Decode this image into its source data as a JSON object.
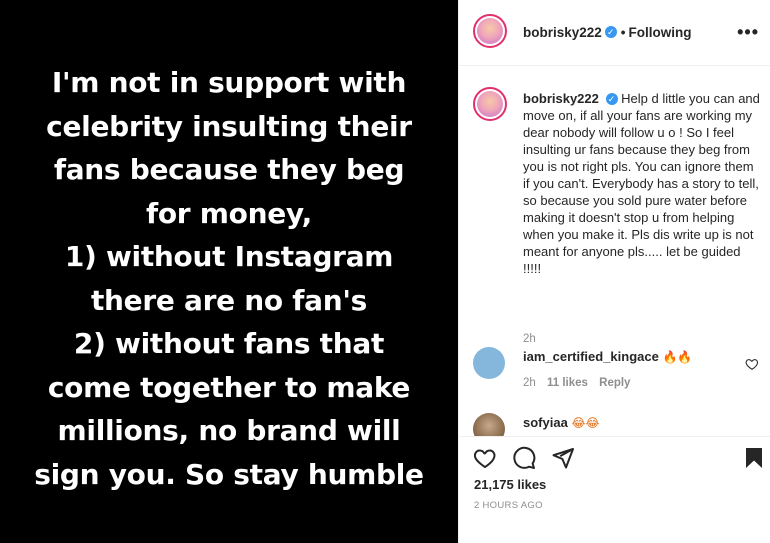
{
  "post": {
    "text_lines": [
      "I'm not in support with",
      "celebrity insulting their",
      "fans because they beg",
      "for money,",
      "1) without Instagram",
      "there are no fan's",
      "2) without fans that",
      "come together to make",
      "millions, no brand will",
      "sign you. So stay humble"
    ]
  },
  "header": {
    "username": "bobrisky222",
    "verified": "✓",
    "separator": "•",
    "follow_state": "Following",
    "more_icon": "•••"
  },
  "caption": {
    "username": "bobrisky222",
    "verified": "✓",
    "text": "Help d little you can and move on, if all your fans are working my dear nobody will follow u o ! So I feel insulting ur fans because they beg from you is not right pls. You can ignore them if you can't. Everybody has a story to tell, so because you sold pure water before making it doesn't stop u from helping when you make it. Pls dis write up is not meant for anyone pls..... let be guided !!!!!",
    "time": "2h"
  },
  "comments": [
    {
      "username": "iam_certified_kingace",
      "emoji": "🔥🔥",
      "time": "2h",
      "likes": "11 likes",
      "reply": "Reply"
    },
    {
      "username": "sofyiaa",
      "emoji": "😂😂"
    }
  ],
  "actions": {
    "likes": "21,175 likes",
    "timestamp": "2 HOURS AGO"
  },
  "colors": {
    "image_bg": "#000000",
    "text_primary": "#262626",
    "text_secondary": "#8e8e8e",
    "verified": "#3897f0"
  }
}
